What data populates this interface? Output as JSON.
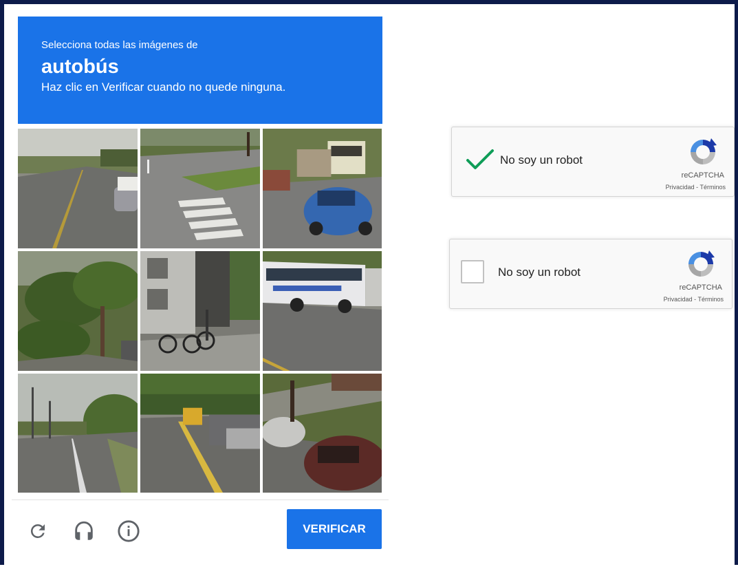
{
  "challenge": {
    "intro": "Selecciona todas las imágenes de",
    "target": "autobús",
    "hint": "Haz clic en Verificar cuando no quede ninguna.",
    "verify_label": "VERIFICAR",
    "header_color": "#1a73e8",
    "icons": [
      "reload-icon",
      "headphones-icon",
      "info-icon"
    ],
    "tiles": [
      "tile-1",
      "tile-2",
      "tile-3",
      "tile-4",
      "tile-5",
      "tile-6",
      "tile-7",
      "tile-8",
      "tile-9"
    ]
  },
  "widget_checked": {
    "label": "No soy un robot",
    "brand": "reCAPTCHA",
    "legal": "Privacidad - Términos",
    "checked": true,
    "check_color": "#0f9d58"
  },
  "widget_unchecked": {
    "label": "No soy un robot",
    "brand": "reCAPTCHA",
    "legal": "Privacidad - Términos",
    "checked": false
  }
}
